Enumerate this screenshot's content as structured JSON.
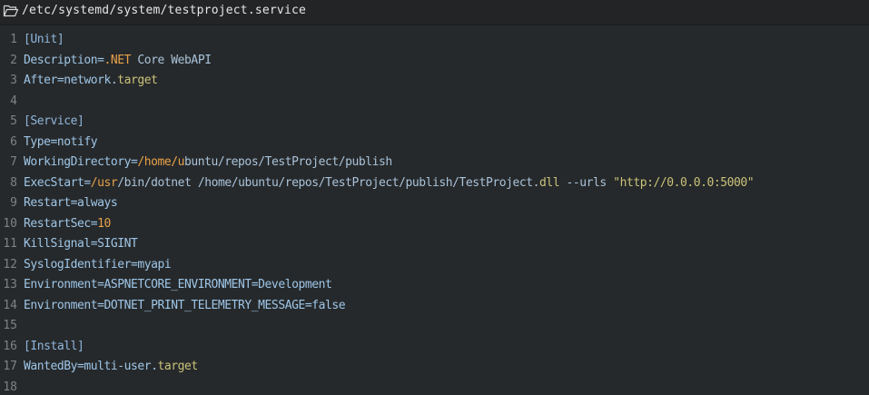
{
  "window": {
    "file_path": "/etc/systemd/system/testproject.service",
    "icons": {
      "folder": "folder-open-icon"
    },
    "colors": {
      "background": "#26292b",
      "title_bar": "#222426",
      "line_number": "#7e8286",
      "text": "#a9c2d9",
      "accent": "#e8a14a",
      "string": "#c9c27a"
    }
  },
  "editor": {
    "lines": [
      {
        "number": "1",
        "segments": [
          {
            "text": "[Unit]",
            "style": "section"
          }
        ]
      },
      {
        "number": "2",
        "segments": [
          {
            "text": "Description=",
            "style": "key"
          },
          {
            "text": ".NET",
            "style": "accent"
          },
          {
            "text": " Core WebAPI",
            "style": "val"
          }
        ]
      },
      {
        "number": "3",
        "segments": [
          {
            "text": "After=network.",
            "style": "key"
          },
          {
            "text": "target",
            "style": "str"
          }
        ]
      },
      {
        "number": "4",
        "segments": []
      },
      {
        "number": "5",
        "segments": [
          {
            "text": "[Service]",
            "style": "section"
          }
        ]
      },
      {
        "number": "6",
        "segments": [
          {
            "text": "Type=notify",
            "style": "key"
          }
        ]
      },
      {
        "number": "7",
        "segments": [
          {
            "text": "WorkingDirectory=",
            "style": "key"
          },
          {
            "text": "/home/u",
            "style": "accent"
          },
          {
            "text": "buntu/repos/TestProject/publish",
            "style": "val"
          }
        ]
      },
      {
        "number": "8",
        "segments": [
          {
            "text": "ExecStart=",
            "style": "key"
          },
          {
            "text": "/usr",
            "style": "accent"
          },
          {
            "text": "/bin/dotnet /home/ubuntu/repos/TestProject/publish/TestProject.",
            "style": "val"
          },
          {
            "text": "dll",
            "style": "str"
          },
          {
            "text": " --urls ",
            "style": "val"
          },
          {
            "text": "\"http://0.0.0.0:5000\"",
            "style": "str"
          }
        ]
      },
      {
        "number": "9",
        "segments": [
          {
            "text": "Restart=always",
            "style": "key"
          }
        ]
      },
      {
        "number": "10",
        "segments": [
          {
            "text": "RestartSec=",
            "style": "key"
          },
          {
            "text": "10",
            "style": "num"
          }
        ]
      },
      {
        "number": "11",
        "segments": [
          {
            "text": "KillSignal=SIGINT",
            "style": "key"
          }
        ]
      },
      {
        "number": "12",
        "segments": [
          {
            "text": "SyslogIdentifier=myapi",
            "style": "key"
          }
        ]
      },
      {
        "number": "13",
        "segments": [
          {
            "text": "Environment=ASPNETCORE_ENVIRONMENT=Development",
            "style": "key"
          }
        ]
      },
      {
        "number": "14",
        "segments": [
          {
            "text": "Environment=DOTNET_PRINT_TELEMETRY_MESSAGE=false",
            "style": "key"
          }
        ]
      },
      {
        "number": "15",
        "segments": []
      },
      {
        "number": "16",
        "segments": [
          {
            "text": "[Install]",
            "style": "section"
          }
        ]
      },
      {
        "number": "17",
        "segments": [
          {
            "text": "WantedBy=multi-user.",
            "style": "key"
          },
          {
            "text": "target",
            "style": "str"
          }
        ]
      },
      {
        "number": "18",
        "segments": []
      }
    ]
  }
}
